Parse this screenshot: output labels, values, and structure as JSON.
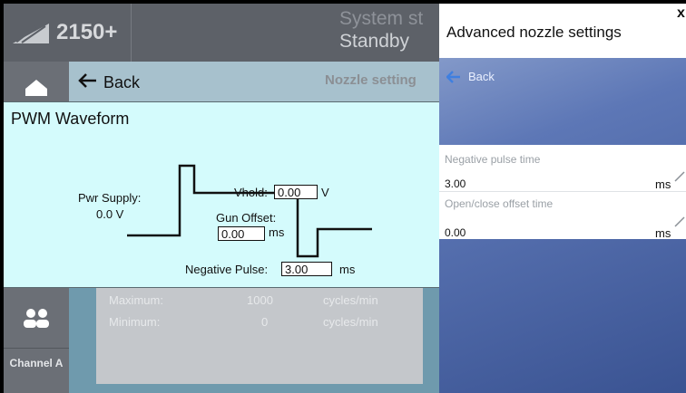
{
  "app": {
    "model": "2150+",
    "system_status_title": "System st",
    "system_status_value": "Standby",
    "back_label": "Back",
    "section_title": "Nozzle setting",
    "channel_label": "Channel A"
  },
  "rows": [
    {
      "label": "Maximum:",
      "value": "1000",
      "unit": "cycles/min"
    },
    {
      "label": "Minimum:",
      "value": "0",
      "unit": "cycles/min"
    }
  ],
  "pwm": {
    "title": "PWM Waveform",
    "pwr_supply_label": "Pwr Supply:",
    "pwr_supply_value": "0.0 V",
    "vhold_label": "Vhold:",
    "vhold_value": "0.00",
    "vhold_unit": "V",
    "gun_offset_label": "Gun Offset:",
    "gun_offset_value": "0.00",
    "gun_offset_unit": "ms",
    "negative_pulse_label": "Negative Pulse:",
    "negative_pulse_value": "3.00",
    "negative_pulse_unit": "ms"
  },
  "dialog": {
    "title": "Advanced nozzle settings",
    "close_label": "x",
    "back_label": "Back",
    "settings": [
      {
        "label": "Negative pulse time",
        "value": "3.00",
        "unit": "ms"
      },
      {
        "label": "Open/close offset time",
        "value": "0.00",
        "unit": "ms"
      }
    ]
  },
  "colors": {
    "panel_bg": "#d4fbfc",
    "dialog_gradient_start": "#95a9d2",
    "dialog_gradient_end": "#3a5392",
    "back_arrow": "#3f7fe0"
  },
  "icons": [
    "logo-icon",
    "home-icon",
    "back-arrow-icon",
    "users-icon",
    "pencil-icon"
  ]
}
